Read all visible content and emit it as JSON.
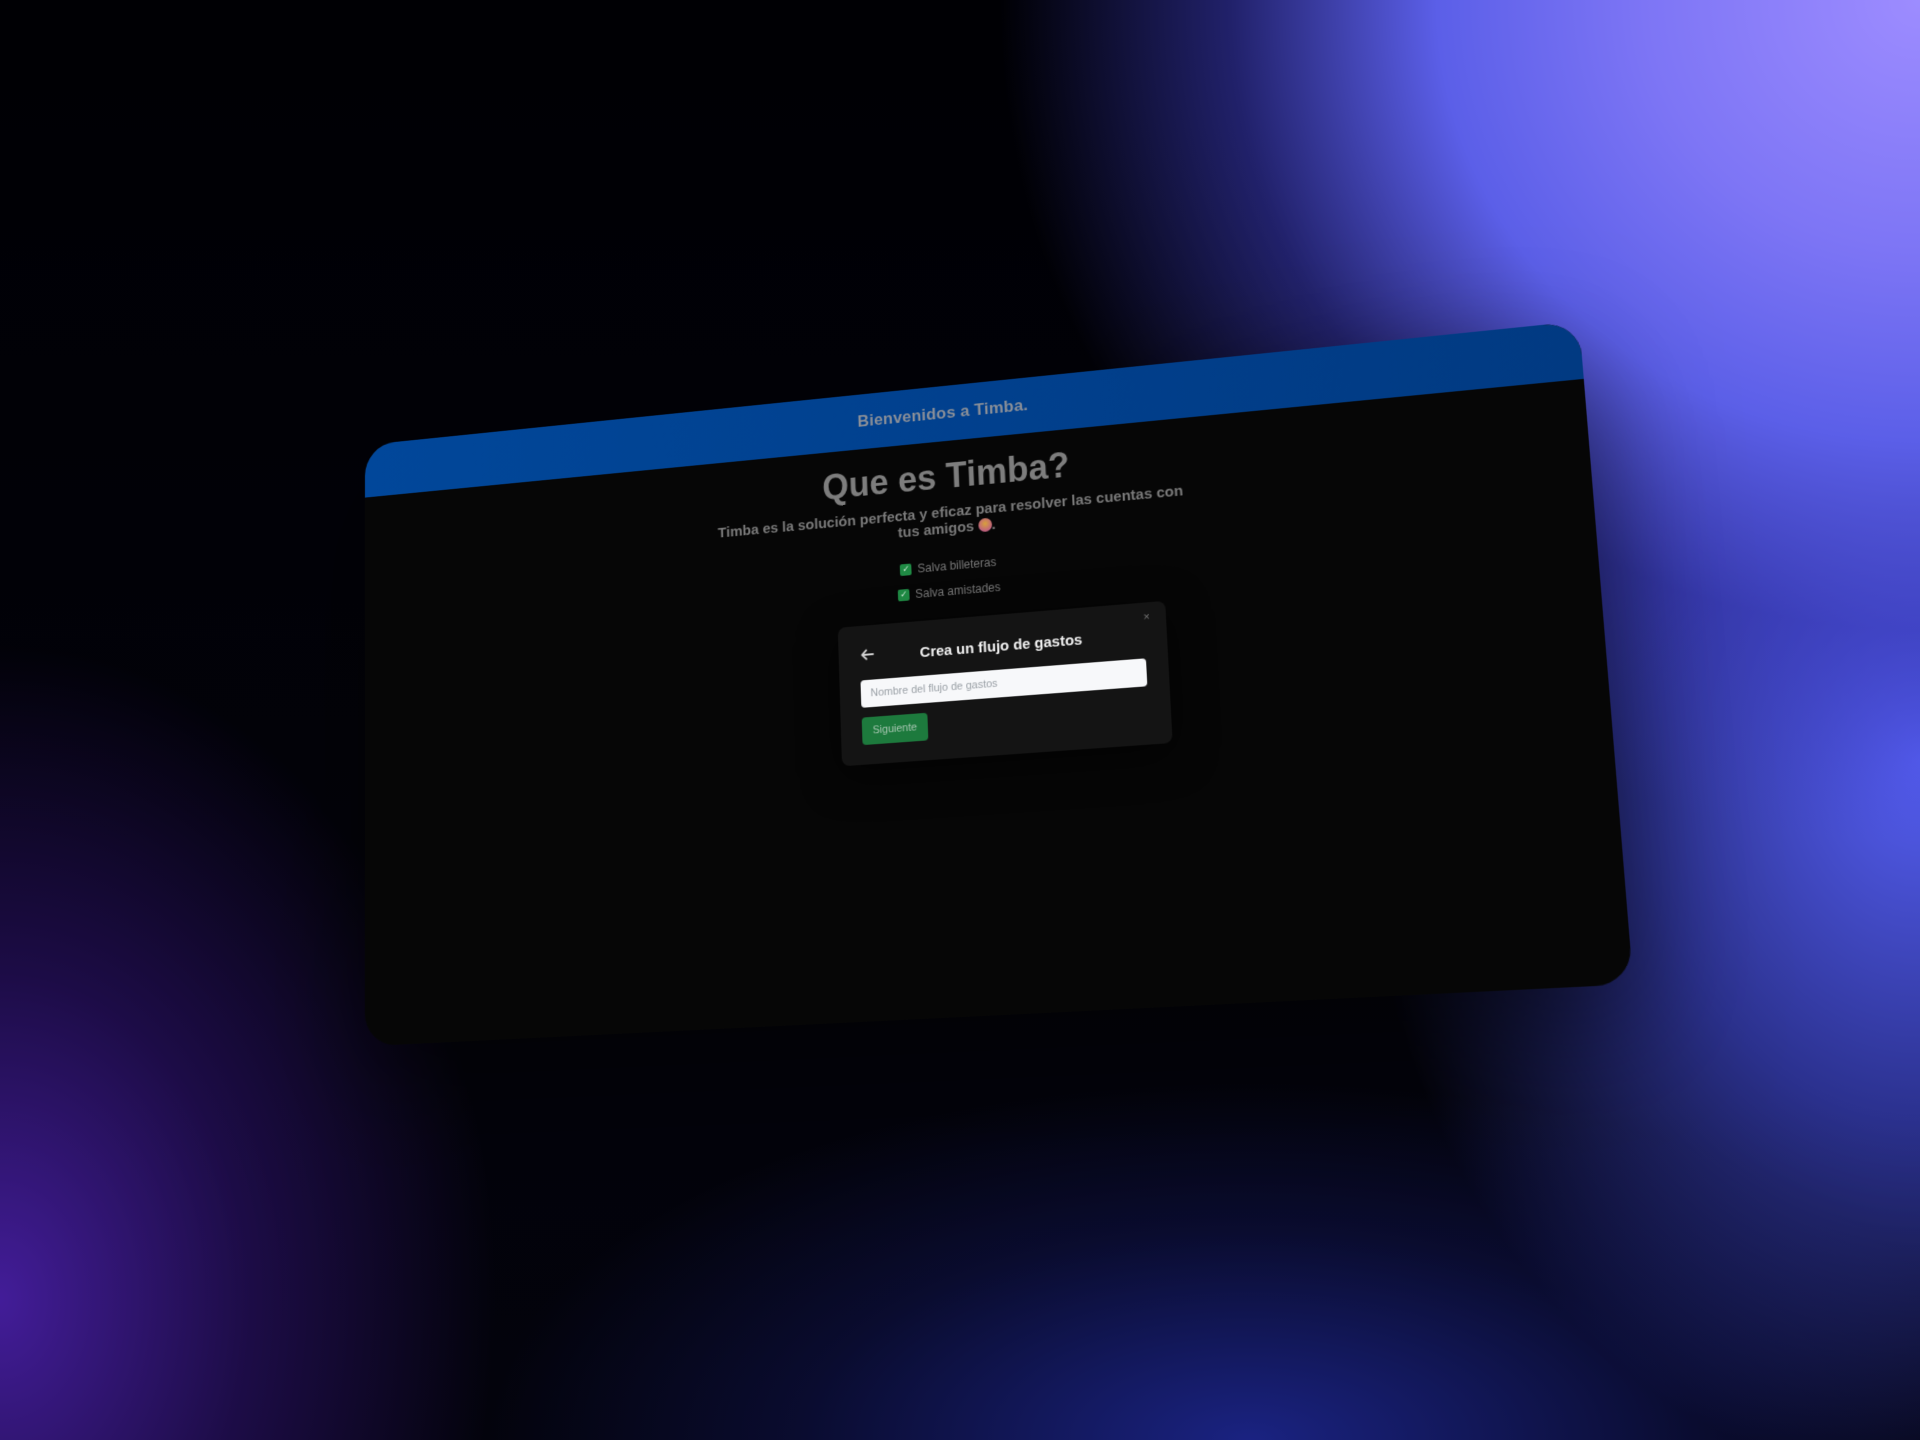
{
  "app": {
    "header_title": "Bienvenidos a Timba."
  },
  "hero": {
    "title": "Que es Timba?",
    "description": "Timba es la solución perfecta y eficaz para resolver las cuentas con tus amigos",
    "description_suffix": "."
  },
  "features": [
    {
      "label": "Salva billeteras",
      "icon": "checkbox-icon"
    },
    {
      "label": "Salva amistades",
      "icon": "checkbox-icon"
    }
  ],
  "modal": {
    "title": "Crea un flujo de gastos",
    "input_placeholder": "Nombre del flujo de gastos",
    "input_value": "",
    "next_label": "Siguiente",
    "close_symbol": "×",
    "back_icon": "arrow-left-icon"
  },
  "colors": {
    "header_bg": "#01479a",
    "screen_bg": "#060606",
    "accent_green": "#1d7a3d"
  }
}
